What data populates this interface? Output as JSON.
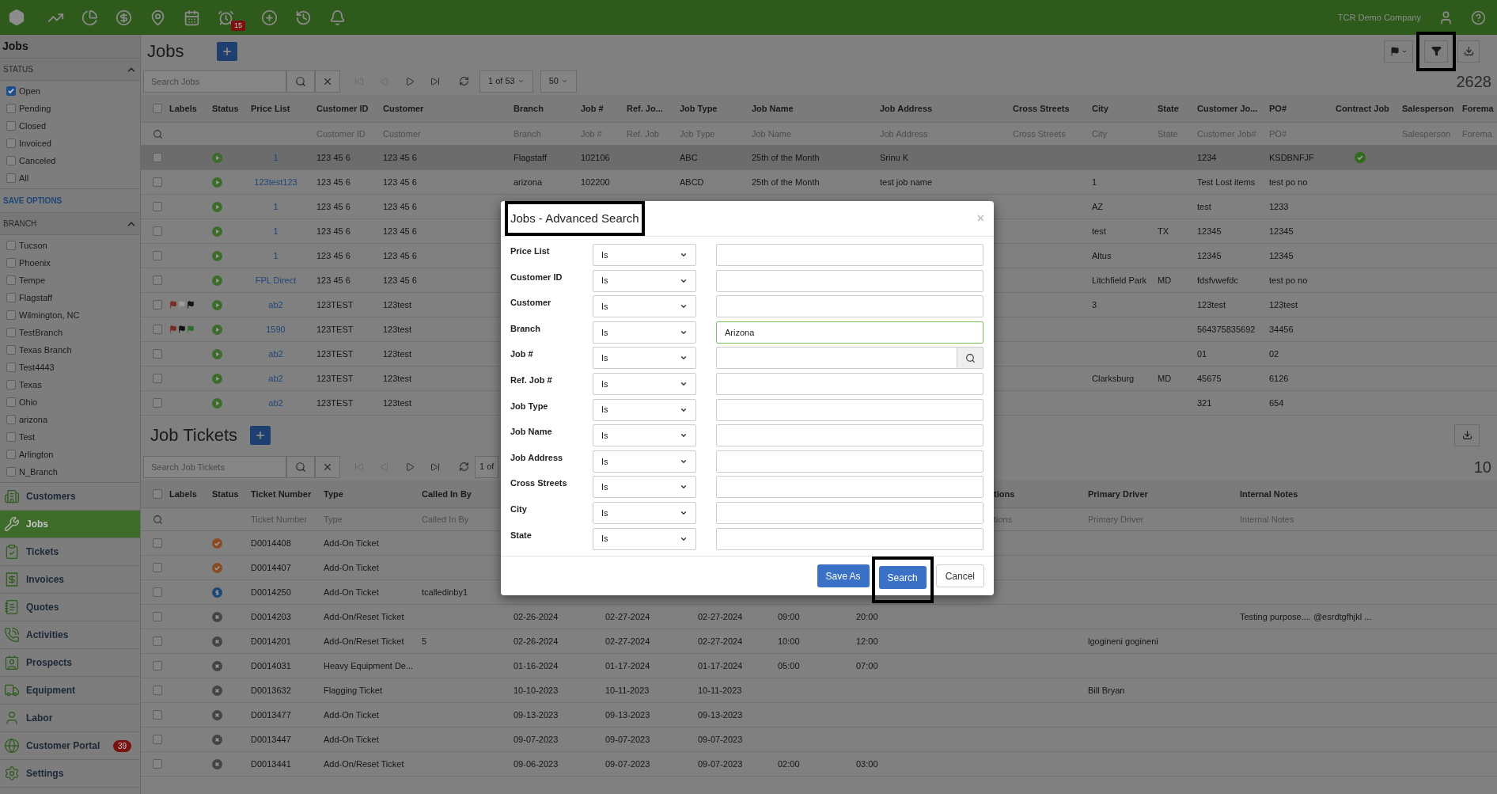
{
  "top_bar": {
    "reminder_badge": "15",
    "company": "TCR Demo Company"
  },
  "sidebar": {
    "title": "Jobs",
    "status_section": {
      "title": "STATUS",
      "expanded": true,
      "options": [
        {
          "label": "Open",
          "checked": true
        },
        {
          "label": "Pending",
          "checked": false
        },
        {
          "label": "Closed",
          "checked": false
        },
        {
          "label": "Invoiced",
          "checked": false
        },
        {
          "label": "Canceled",
          "checked": false
        },
        {
          "label": "All",
          "checked": false
        }
      ]
    },
    "save_options": "SAVE OPTIONS",
    "branch_section": {
      "title": "BRANCH",
      "expanded": true,
      "options": [
        {
          "label": "Tucson",
          "checked": false
        },
        {
          "label": "Phoenix",
          "checked": false
        },
        {
          "label": "Tempe",
          "checked": false
        },
        {
          "label": "Flagstaff",
          "checked": false
        },
        {
          "label": "Wilmington, NC",
          "checked": false
        },
        {
          "label": "TestBranch",
          "checked": false
        },
        {
          "label": "Texas Branch",
          "checked": false
        },
        {
          "label": "Test4443",
          "checked": false
        },
        {
          "label": "Texas",
          "checked": false
        },
        {
          "label": "Ohio",
          "checked": false
        },
        {
          "label": "arizona",
          "checked": false
        },
        {
          "label": "Test",
          "checked": false
        },
        {
          "label": "Arlington",
          "checked": false
        },
        {
          "label": "N_Branch",
          "checked": false
        }
      ]
    },
    "nav": [
      {
        "label": "Customers",
        "selected": false
      },
      {
        "label": "Jobs",
        "selected": true
      },
      {
        "label": "Tickets",
        "selected": false
      },
      {
        "label": "Invoices",
        "selected": false
      },
      {
        "label": "Quotes",
        "selected": false
      },
      {
        "label": "Activities",
        "selected": false
      },
      {
        "label": "Prospects",
        "selected": false
      },
      {
        "label": "Equipment",
        "selected": false
      },
      {
        "label": "Labor",
        "selected": false
      },
      {
        "label": "Customer Portal",
        "selected": false,
        "badge": "39"
      },
      {
        "label": "Settings",
        "selected": false
      }
    ]
  },
  "jobs": {
    "title": "Jobs",
    "filter_highlighted": true,
    "search": {
      "placeholder": "Search Jobs"
    },
    "pager": {
      "page": "1 of 53",
      "page_size": "50",
      "first_disabled": true,
      "prev_disabled": true
    },
    "count": "2628",
    "all_checked": false,
    "columns": [
      {
        "label": "Labels"
      },
      {
        "label": "Status"
      },
      {
        "label": "Price List"
      },
      {
        "label": "Customer ID",
        "filter": "Customer ID"
      },
      {
        "label": "Customer",
        "filter": "Customer"
      },
      {
        "label": "Branch",
        "filter": "Branch"
      },
      {
        "label": "Job #",
        "filter": "Job #"
      },
      {
        "label": "Ref. Jo...",
        "filter": "Ref. Job"
      },
      {
        "label": "Job Type",
        "filter": "Job Type"
      },
      {
        "label": "Job Name",
        "filter": "Job Name"
      },
      {
        "label": "Job Address",
        "filter": "Job Address"
      },
      {
        "label": "Cross Streets",
        "filter": "Cross Streets"
      },
      {
        "label": "City",
        "filter": "City"
      },
      {
        "label": "State",
        "filter": "State"
      },
      {
        "label": "Customer Jo...",
        "filter": "Customer Job#"
      },
      {
        "label": "PO#",
        "filter": "PO#"
      },
      {
        "label": "Contract Job"
      },
      {
        "label": "Salesperson",
        "filter": "Salesperson"
      },
      {
        "label": "Forema",
        "filter": "Forema"
      }
    ],
    "rows": [
      {
        "checked": false,
        "selected": true,
        "status": {
          "kind": "open",
          "color": "#3d6b2a"
        },
        "price_list": "1",
        "customer_id": "123 45 6",
        "customer": "123 45 6",
        "branch": "Flagstaff",
        "job_no": "102106",
        "job_type": "ABC",
        "job_name": "25th of the Month",
        "job_address": "Srinu K",
        "customer_job": "1234",
        "po": "KSDBNFJF",
        "contract": true
      },
      {
        "checked": false,
        "selected": false,
        "status": {
          "kind": "open",
          "color": "#3d6b2a"
        },
        "price_list": "123test123",
        "customer_id": "123 45 6",
        "customer": "123 45 6",
        "branch": "arizona",
        "job_no": "102200",
        "job_type": "ABCD",
        "job_name": "25th of the Month",
        "job_address": "test job name",
        "city": "1",
        "customer_job": "Test Lost items",
        "po": "test po no",
        "contract": false
      },
      {
        "checked": false,
        "selected": false,
        "status": {
          "kind": "open",
          "color": "#3d6b2a"
        },
        "price_list": "1",
        "customer_id": "123 45 6",
        "customer": "123 45 6",
        "city": "AZ",
        "customer_job": "test",
        "po": "1233",
        "contract": false
      },
      {
        "checked": false,
        "selected": false,
        "status": {
          "kind": "open",
          "color": "#3d6b2a"
        },
        "price_list": "1",
        "customer_id": "123 45 6",
        "customer": "123 45 6",
        "city": "test",
        "state": "TX",
        "customer_job": "12345",
        "po": "12345",
        "contract": false
      },
      {
        "checked": false,
        "selected": false,
        "status": {
          "kind": "open",
          "color": "#3d6b2a"
        },
        "price_list": "1",
        "customer_id": "123 45 6",
        "customer": "123 45 6",
        "city": "Altus",
        "customer_job": "12345",
        "po": "12345",
        "contract": false
      },
      {
        "checked": false,
        "selected": false,
        "status": {
          "kind": "open",
          "color": "#3d6b2a"
        },
        "price_list": "FPL Direct",
        "customer_id": "123 45 6",
        "customer": "123 45 6",
        "city": "Litchfield Park",
        "state": "MD",
        "customer_job": "fdsfvwefdc",
        "po": "test po no",
        "contract": false
      },
      {
        "checked": false,
        "selected": false,
        "status": {
          "kind": "open",
          "color": "#3d6b2a"
        },
        "labels": [
          {
            "color": "#7a2a22"
          },
          {
            "color": "#9a9a9a"
          },
          {
            "color": "#111111"
          }
        ],
        "price_list": "ab2",
        "customer_id": "123TEST",
        "customer": "123test",
        "city": "3",
        "customer_job": "123test",
        "po": "123test",
        "contract": false
      },
      {
        "checked": false,
        "selected": false,
        "status": {
          "kind": "open",
          "color": "#3d6b2a"
        },
        "labels": [
          {
            "color": "#7a2a22"
          },
          {
            "color": "#111111"
          },
          {
            "color": "#2f6b2f"
          }
        ],
        "price_list": "1590",
        "customer_id": "123TEST",
        "customer": "123test",
        "customer_job": "564375835692",
        "po": "34456",
        "contract": false
      },
      {
        "checked": false,
        "selected": false,
        "status": {
          "kind": "open",
          "color": "#3d6b2a"
        },
        "price_list": "ab2",
        "customer_id": "123TEST",
        "customer": "123test",
        "customer_job": "01",
        "po": "02",
        "contract": false
      },
      {
        "checked": false,
        "selected": false,
        "status": {
          "kind": "open",
          "color": "#3d6b2a"
        },
        "price_list": "ab2",
        "customer_id": "123TEST",
        "customer": "123test",
        "city": "Clarksburg",
        "state": "MD",
        "customer_job": "45675",
        "po": "6126",
        "contract": false
      },
      {
        "checked": false,
        "selected": false,
        "status": {
          "kind": "open",
          "color": "#3d6b2a"
        },
        "price_list": "ab2",
        "customer_id": "123TEST",
        "customer": "123test",
        "customer_job": "321",
        "po": "654",
        "contract": false
      }
    ]
  },
  "job_tickets": {
    "title": "Job Tickets",
    "search": {
      "placeholder": "Search Job Tickets"
    },
    "pager": {
      "page": "1 of",
      "first_disabled": true,
      "prev_disabled": true
    },
    "count": "10",
    "all_checked": false,
    "columns": [
      {
        "label": "Labels"
      },
      {
        "label": "Status"
      },
      {
        "label": "Ticket Number",
        "filter": "Ticket Number"
      },
      {
        "label": "Type",
        "filter": "Type"
      },
      {
        "label": "Called In By",
        "filter": "Called In By"
      },
      {
        "label": "tions",
        "filter": "tions"
      },
      {
        "label": "Primary Driver",
        "filter": "Primary Driver"
      },
      {
        "label": "Internal Notes",
        "filter": "Internal Notes"
      }
    ],
    "rows": [
      {
        "checked": false,
        "status": {
          "kind": "done",
          "color": "#8a4a22"
        },
        "ticket_number": "D0014408",
        "type": "Add-On Ticket"
      },
      {
        "checked": false,
        "status": {
          "kind": "done",
          "color": "#8a4a22"
        },
        "ticket_number": "D0014407",
        "type": "Add-On Ticket"
      },
      {
        "checked": false,
        "status": {
          "kind": "invoiced",
          "color": "#1e4677"
        },
        "ticket_number": "D0014250",
        "type": "Add-On Ticket",
        "called_in_by": "tcalledinby1"
      },
      {
        "checked": false,
        "status": {
          "kind": "closed",
          "color": "#444444"
        },
        "ticket_number": "D0014203",
        "type": "Add-On/Reset Ticket",
        "column_6": "02-26-2024",
        "column_7": "02-27-2024",
        "column_8": "02-27-2024",
        "column_9": "09:00",
        "column_10": "20:00",
        "internal_notes": "Testing purpose.... @esrdtgfhjkl ..."
      },
      {
        "checked": false,
        "status": {
          "kind": "closed",
          "color": "#444444"
        },
        "ticket_number": "D0014201",
        "type": "Add-On/Reset Ticket",
        "called_in_by": "5",
        "column_6": "02-26-2024",
        "column_7": "02-27-2024",
        "column_8": "02-27-2024",
        "column_9": "10:00",
        "column_10": "12:00",
        "primary_driver": "lgogineni gogineni"
      },
      {
        "checked": false,
        "status": {
          "kind": "closed",
          "color": "#444444"
        },
        "ticket_number": "D0014031",
        "type": "Heavy Equipment De...",
        "column_6": "01-16-2024",
        "column_7": "01-17-2024",
        "column_8": "01-17-2024",
        "column_9": "05:00",
        "column_10": "07:00"
      },
      {
        "checked": false,
        "status": {
          "kind": "closed",
          "color": "#444444"
        },
        "ticket_number": "D0013632",
        "type": "Flagging Ticket",
        "column_6": "10-10-2023",
        "column_7": "10-11-2023",
        "column_8": "10-11-2023",
        "primary_driver": "Bill Bryan"
      },
      {
        "checked": false,
        "status": {
          "kind": "closed",
          "color": "#444444"
        },
        "ticket_number": "D0013477",
        "type": "Add-On Ticket",
        "column_6": "09-13-2023",
        "column_7": "09-13-2023",
        "column_8": "09-13-2023"
      },
      {
        "checked": false,
        "status": {
          "kind": "closed",
          "color": "#444444"
        },
        "ticket_number": "D0013447",
        "type": "Add-On Ticket",
        "column_6": "09-07-2023",
        "column_7": "09-07-2023",
        "column_8": "09-07-2023"
      },
      {
        "checked": false,
        "status": {
          "kind": "closed",
          "color": "#444444"
        },
        "ticket_number": "D0013441",
        "type": "Add-On/Reset Ticket",
        "column_6": "09-06-2023",
        "column_7": "09-07-2023",
        "column_8": "09-07-2023",
        "column_9": "02:00",
        "column_10": "03:00"
      }
    ]
  },
  "dialog": {
    "title": "Jobs - Advanced Search",
    "title_highlighted": true,
    "close": "×",
    "fields": [
      {
        "label": "Price List",
        "operator": "Is",
        "kind": "text",
        "focused": false
      },
      {
        "label": "Customer ID",
        "operator": "Is",
        "kind": "text",
        "focused": false
      },
      {
        "label": "Customer",
        "operator": "Is",
        "kind": "text",
        "focused": false
      },
      {
        "label": "Branch",
        "operator": "Is",
        "kind": "text",
        "focused": true,
        "value": "Arizona"
      },
      {
        "label": "Job #",
        "operator": "Is",
        "kind": "lookup",
        "focused": false
      },
      {
        "label": "Ref. Job #",
        "operator": "Is",
        "kind": "text",
        "focused": false
      },
      {
        "label": "Job Type",
        "operator": "Is",
        "kind": "text",
        "focused": false
      },
      {
        "label": "Job Name",
        "operator": "Is",
        "kind": "text",
        "focused": false
      },
      {
        "label": "Job Address",
        "operator": "Is",
        "kind": "text",
        "focused": false
      },
      {
        "label": "Cross Streets",
        "operator": "Is",
        "kind": "text",
        "focused": false
      },
      {
        "label": "City",
        "operator": "Is",
        "kind": "text",
        "focused": false
      },
      {
        "label": "State",
        "operator": "Is",
        "kind": "text",
        "focused": false
      }
    ],
    "buttons": [
      {
        "label": "Save As",
        "kind": "primary",
        "highlighted": false
      },
      {
        "label": "Search",
        "kind": "primary",
        "highlighted": true
      },
      {
        "label": "Cancel",
        "kind": "default",
        "highlighted": false
      }
    ]
  }
}
